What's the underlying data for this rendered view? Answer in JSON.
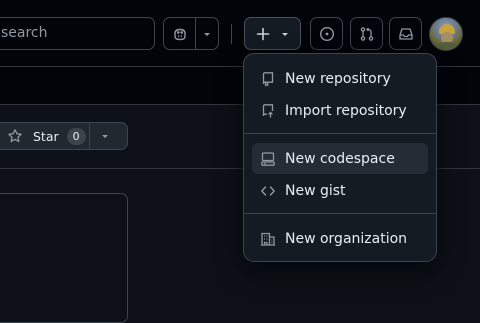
{
  "header": {
    "search": {
      "text": "search"
    },
    "icons": {
      "copilot": "copilot-icon",
      "chevron": "chevron-down-icon",
      "plus": "plus-icon",
      "issues": "issue-opened-icon",
      "pulls": "git-pull-request-icon",
      "inbox": "inbox-icon"
    }
  },
  "repo": {
    "star_label": "Star",
    "star_count": "0"
  },
  "create_menu": {
    "items": [
      {
        "label": "New repository",
        "icon": "repo-icon"
      },
      {
        "label": "Import repository",
        "icon": "repo-push-icon"
      },
      {
        "label": "New codespace",
        "icon": "codespaces-icon",
        "active": true
      },
      {
        "label": "New gist",
        "icon": "code-icon"
      },
      {
        "label": "New organization",
        "icon": "organization-icon"
      }
    ]
  },
  "colors": {
    "background": "#0d1117",
    "header": "#010409",
    "border": "#3d444d",
    "menu_bg": "#151b23",
    "menu_active": "#262c36",
    "text": "#e6edf3",
    "muted": "#9198a1"
  }
}
